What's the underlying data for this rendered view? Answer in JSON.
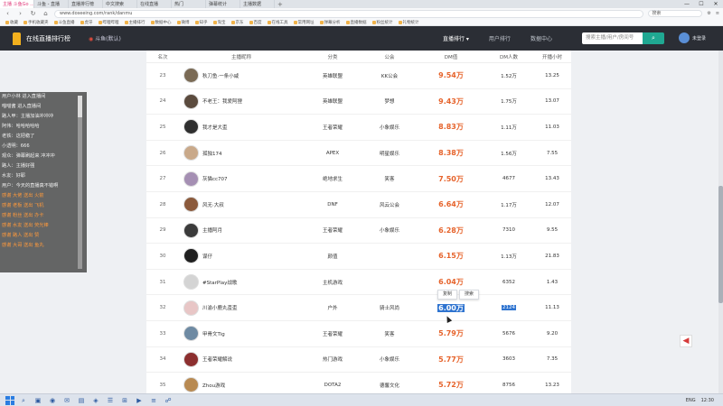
{
  "browser": {
    "tabs": [
      {
        "label": "主播 斗鱼Go ...",
        "active": true
      },
      {
        "label": "斗鱼 - 直播"
      },
      {
        "label": "直播排行榜"
      },
      {
        "label": "中文搜索"
      },
      {
        "label": "在线直播"
      },
      {
        "label": "热门"
      },
      {
        "label": "弹幕统计"
      },
      {
        "label": "主播数据"
      },
      {
        "label": "+"
      }
    ],
    "url": "www.doseeing.com/rank/danmu",
    "search_placeholder": "搜索",
    "bookmarks": [
      "收藏",
      "手机收藏夹",
      "斗鱼直播",
      "虎牙",
      "哔哩哔哩",
      "主播排行",
      "数据中心",
      "微博",
      "知乎",
      "淘宝",
      "京东",
      "百度",
      "在线工具",
      "常用网址",
      "弹幕分析",
      "直播数据",
      "粉丝统计",
      "礼物统计"
    ],
    "window_controls": [
      "—",
      "☐",
      "✕"
    ]
  },
  "site": {
    "title": "在线直播排行榜",
    "location": "斗鱼(默认)",
    "nav": [
      {
        "label": "直播排行 ▾",
        "current": true
      },
      {
        "label": "用户排行"
      },
      {
        "label": "数据中心"
      }
    ],
    "search_placeholder": "搜索主播/用户/房间号",
    "search_button": "⌕",
    "user": "未登录"
  },
  "table": {
    "headers": [
      "名次",
      "主播昵称",
      "分类",
      "公会",
      "DM值",
      "DM人数",
      "开播小时"
    ],
    "rows": [
      {
        "rank": "23",
        "name": "秋刀鱼·一条小咸",
        "category": "英雄联盟",
        "guild": "KK公会",
        "dm": "9.54万",
        "users": "1.52万",
        "hours": "13.25"
      },
      {
        "rank": "24",
        "name": "不老王：我爱阿狸",
        "category": "英雄联盟",
        "guild": "梦想",
        "dm": "9.43万",
        "users": "1.75万",
        "hours": "13.07"
      },
      {
        "rank": "25",
        "name": "我才是大歪",
        "category": "王者荣耀",
        "guild": "小象娱乐",
        "dm": "8.83万",
        "users": "1.11万",
        "hours": "11.03"
      },
      {
        "rank": "26",
        "name": "孤独174",
        "category": "APEX",
        "guild": "明星娱乐",
        "dm": "8.38万",
        "users": "1.56万",
        "hours": "7.55"
      },
      {
        "rank": "27",
        "name": "灰猫cc707",
        "category": "绝地求生",
        "guild": "笑客",
        "dm": "7.50万",
        "users": "4677",
        "hours": "13.43"
      },
      {
        "rank": "28",
        "name": "风无·大叔",
        "category": "DNF",
        "guild": "风云公会",
        "dm": "6.64万",
        "users": "1.17万",
        "hours": "12.07"
      },
      {
        "rank": "29",
        "name": "主播阿月",
        "category": "王者荣耀",
        "guild": "小象娱乐",
        "dm": "6.28万",
        "users": "7310",
        "hours": "9.55"
      },
      {
        "rank": "30",
        "name": "谋仔",
        "category": "颜值",
        "guild": "",
        "dm": "6.15万",
        "users": "1.13万",
        "hours": "21.83"
      },
      {
        "rank": "31",
        "name": "#StarPlay战歌",
        "category": "主机游戏",
        "guild": "",
        "dm": "6.04万",
        "users": "6352",
        "hours": "1.43"
      },
      {
        "rank": "32",
        "name": "川渝小鹿丸歪歪",
        "category": "户外",
        "guild": "骑士风尚",
        "dm": "6.00万",
        "users": "2124",
        "hours": "11.13",
        "selected": true
      },
      {
        "rank": "33",
        "name": "甲骨文Tig",
        "category": "王者荣耀",
        "guild": "笑客",
        "dm": "5.79万",
        "users": "5676",
        "hours": "9.20"
      },
      {
        "rank": "34",
        "name": "王者荣耀解说",
        "category": "热门游戏",
        "guild": "小象娱乐",
        "dm": "5.77万",
        "users": "3603",
        "hours": "7.35"
      },
      {
        "rank": "35",
        "name": "Zhou游戏",
        "category": "DOTA2",
        "guild": "德馨文化",
        "dm": "5.72万",
        "users": "8756",
        "hours": "13.23"
      }
    ]
  },
  "context_menu": [
    "复制",
    "搜索"
  ],
  "chat": {
    "lines": [
      {
        "text": "用户小林 进入直播间",
        "orange": false
      },
      {
        "text": "喵喵酱 进入直播间",
        "orange": false
      },
      {
        "text": "路人甲：主播加油冲冲冲",
        "orange": false
      },
      {
        "text": "阿伟：哈哈哈哈哈",
        "orange": false
      },
      {
        "text": "老铁：这把稳了",
        "orange": false
      },
      {
        "text": "小透明：666",
        "orange": false
      },
      {
        "text": "观众：弹幕刷起来 冲冲冲",
        "orange": false
      },
      {
        "text": "路人：主播好强",
        "orange": false
      },
      {
        "text": "水友：好耶",
        "orange": false
      },
      {
        "text": "用户：今天的直播真不错啊",
        "orange": false
      },
      {
        "text": "感谢 大佬 送出 火箭",
        "orange": true
      },
      {
        "text": "感谢 老板 送出 飞机",
        "orange": true
      },
      {
        "text": "感谢 粉丝 送出 办卡",
        "orange": true
      },
      {
        "text": "感谢 水友 送出 荧光棒",
        "orange": true
      },
      {
        "text": "感谢 路人 送出 赞",
        "orange": true
      },
      {
        "text": "感谢 大哥 送出 鱼丸",
        "orange": true
      }
    ]
  },
  "taskbar": {
    "icons": [
      "⌕",
      "▣",
      "◉",
      "✉",
      "▤",
      "◈",
      "☰",
      "⊞",
      "▶",
      "≡",
      "☍"
    ],
    "tray": [
      "ENG",
      "12:30"
    ]
  },
  "colors": {
    "dm_value": "#e6632b",
    "header_bg": "#2b2e35",
    "accent": "#20a892",
    "selection": "#2f74d0"
  }
}
